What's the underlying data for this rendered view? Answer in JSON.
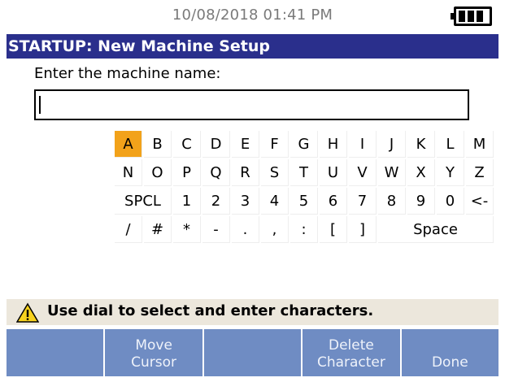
{
  "status": {
    "datetime": "10/08/2018 01:41 PM",
    "battery_icon": "battery-full-icon"
  },
  "title": "STARTUP: New Machine Setup",
  "prompt": "Enter the machine name:",
  "name_input": {
    "value": ""
  },
  "keyboard": {
    "selected": "A",
    "row1": [
      "A",
      "B",
      "C",
      "D",
      "E",
      "F",
      "G",
      "H",
      "I",
      "J",
      "K",
      "L",
      "M"
    ],
    "row2": [
      "N",
      "O",
      "P",
      "Q",
      "R",
      "S",
      "T",
      "U",
      "V",
      "W",
      "X",
      "Y",
      "Z"
    ],
    "row3": [
      "SPCL",
      "1",
      "2",
      "3",
      "4",
      "5",
      "6",
      "7",
      "8",
      "9",
      "0",
      "<-"
    ],
    "row4": [
      "/",
      "#",
      "*",
      "-",
      ".",
      ",",
      ":",
      "[",
      "]",
      "Space"
    ]
  },
  "hint": {
    "icon": "warning-icon",
    "text": "Use dial to select and enter characters."
  },
  "softkeys": [
    {
      "line1": "",
      "line2": ""
    },
    {
      "line1": "Move",
      "line2": "Cursor"
    },
    {
      "line1": "",
      "line2": ""
    },
    {
      "line1": "Delete",
      "line2": "Character"
    },
    {
      "line1": "",
      "line2": "Done"
    }
  ],
  "colors": {
    "title_bg": "#2a2f8c",
    "selected_key": "#f2a21a",
    "softkey_bg": "#6f8cc3",
    "hint_bg": "#ece7dc"
  }
}
